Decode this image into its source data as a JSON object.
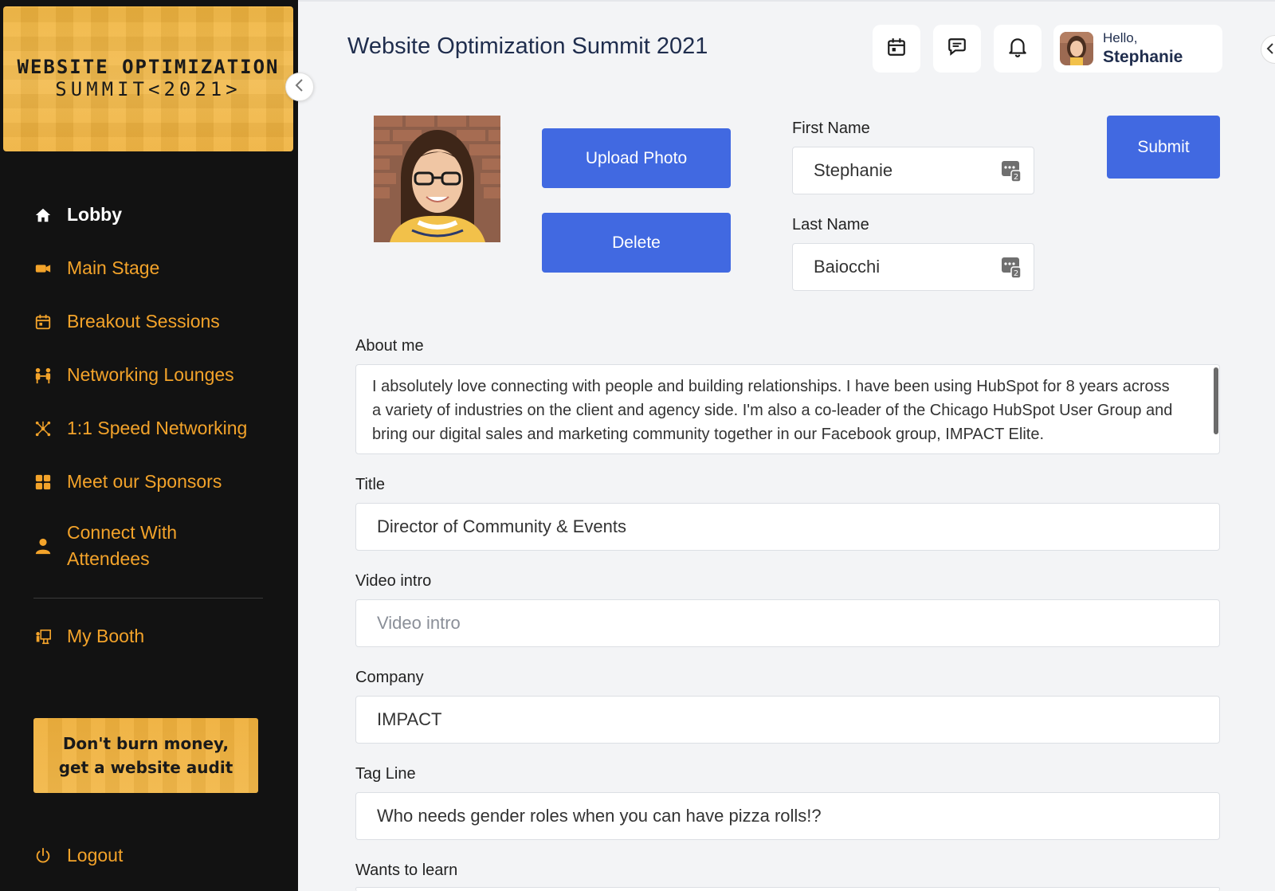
{
  "sidebar": {
    "brand_line1": "WEBSITE OPTIMIZATION",
    "brand_line2": "SUMMIT<2021>",
    "nav": [
      {
        "label": "Lobby",
        "icon": "home-icon"
      },
      {
        "label": "Main Stage",
        "icon": "video-camera-icon"
      },
      {
        "label": "Breakout Sessions",
        "icon": "calendar-icon"
      },
      {
        "label": "Networking Lounges",
        "icon": "people-icon"
      },
      {
        "label": "1:1 Speed Networking",
        "icon": "network-icon"
      },
      {
        "label": "Meet our Sponsors",
        "icon": "grid-icon"
      },
      {
        "label": "Connect With Attendees",
        "icon": "person-icon"
      },
      {
        "label": "My Booth",
        "icon": "booth-icon"
      }
    ],
    "promo_line1": "Don't burn money,",
    "promo_line2": "get a website audit",
    "logout_label": "Logout"
  },
  "header": {
    "title": "Website Optimization Summit 2021",
    "greeting": "Hello,",
    "user_name": "Stephanie"
  },
  "profile": {
    "upload_label": "Upload Photo",
    "delete_label": "Delete",
    "submit_label": "Submit",
    "first_name_label": "First Name",
    "first_name": "Stephanie",
    "last_name_label": "Last Name",
    "last_name": "Baiocchi",
    "about_label": "About me",
    "about": "I absolutely love connecting with people and building relationships. I have been using HubSpot for 8 years across a variety of industries on the client and agency side. I'm also a co-leader of the Chicago HubSpot User Group and bring our digital sales and marketing community together in our Facebook group, IMPACT Elite.",
    "title_label": "Title",
    "title": "Director of Community & Events",
    "video_label": "Video intro",
    "video_placeholder": "Video intro",
    "company_label": "Company",
    "company": "IMPACT",
    "tagline_label": "Tag Line",
    "tagline": "Who needs gender roles when you can have pizza rolls!?",
    "wants_label": "Wants to learn"
  },
  "colors": {
    "sidebar_bg": "#121212",
    "accent_orange": "#f3a32a",
    "brand_gold": "#f0b43e",
    "button_blue": "#4169e1",
    "title_navy": "#1f2d4d"
  }
}
